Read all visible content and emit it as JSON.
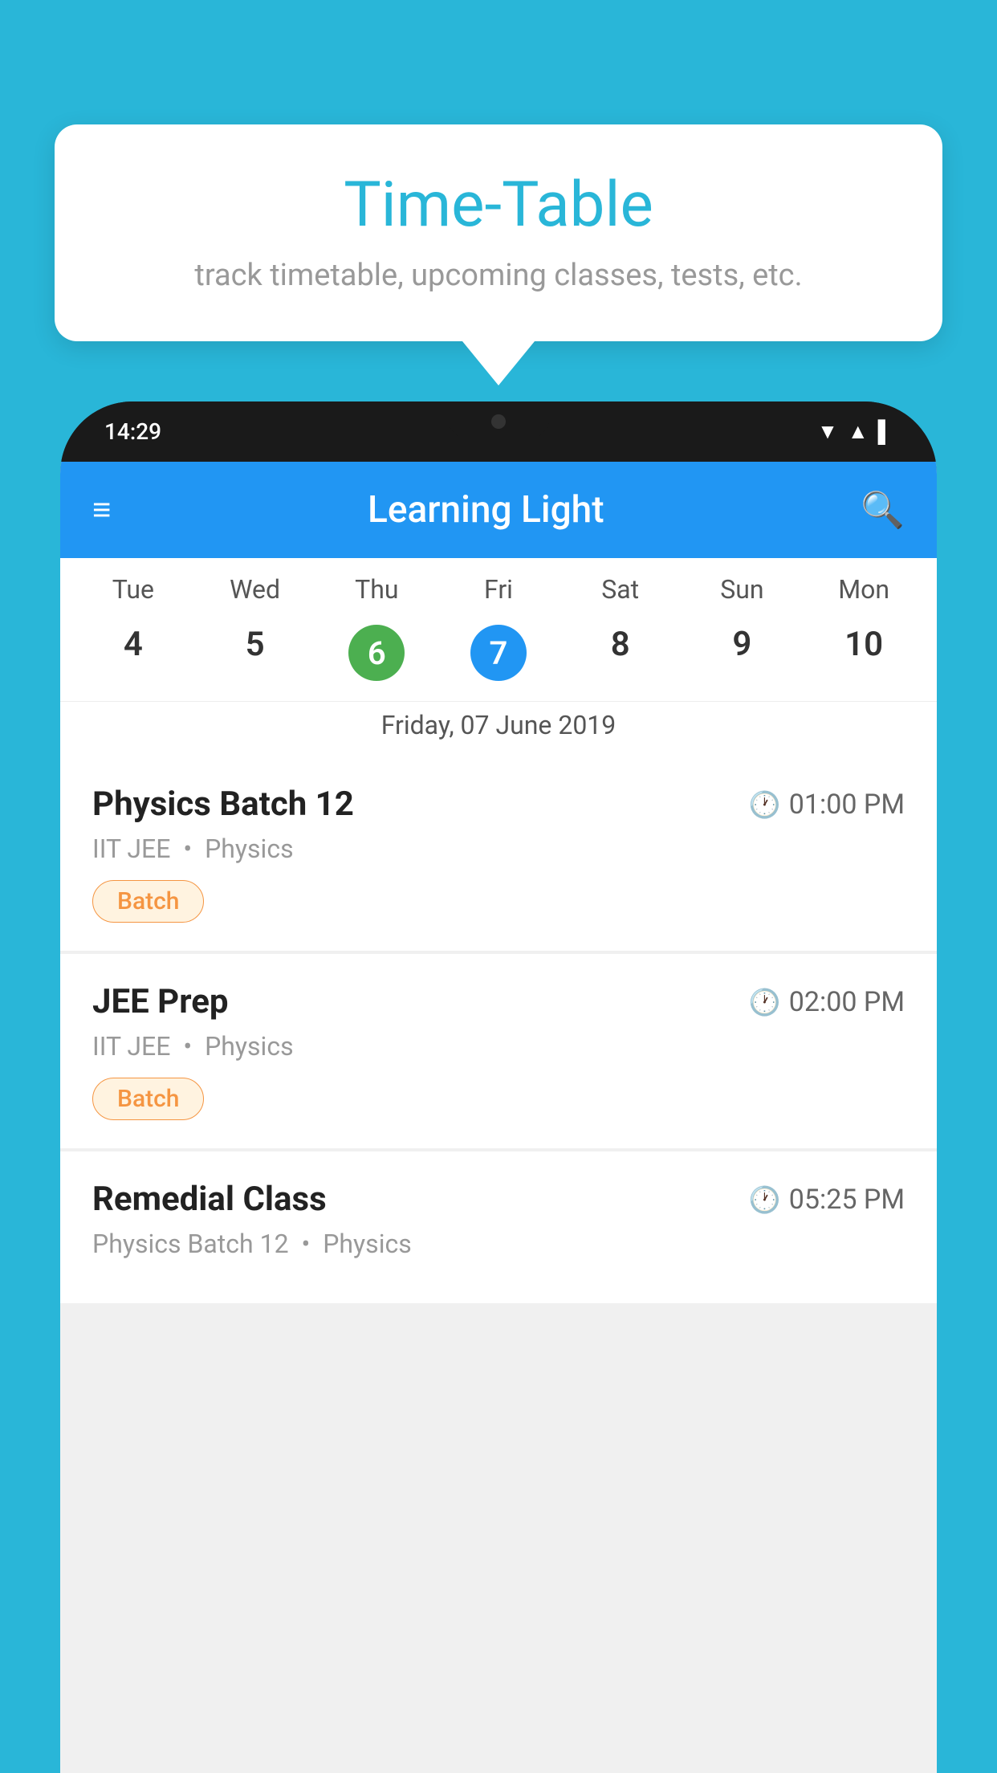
{
  "page": {
    "background_color": "#29B6D8"
  },
  "speech_bubble": {
    "title": "Time-Table",
    "subtitle": "track timetable, upcoming classes, tests, etc."
  },
  "phone": {
    "status_bar": {
      "time": "14:29"
    },
    "app_bar": {
      "title": "Learning Light"
    },
    "calendar": {
      "days": [
        "Tue",
        "Wed",
        "Thu",
        "Fri",
        "Sat",
        "Sun",
        "Mon"
      ],
      "dates": [
        "4",
        "5",
        "6",
        "7",
        "8",
        "9",
        "10"
      ],
      "today_index": 2,
      "selected_index": 3,
      "selected_date_label": "Friday, 07 June 2019"
    },
    "schedule": [
      {
        "title": "Physics Batch 12",
        "time": "01:00 PM",
        "subtitle_course": "IIT JEE",
        "subtitle_subject": "Physics",
        "badge": "Batch"
      },
      {
        "title": "JEE Prep",
        "time": "02:00 PM",
        "subtitle_course": "IIT JEE",
        "subtitle_subject": "Physics",
        "badge": "Batch"
      },
      {
        "title": "Remedial Class",
        "time": "05:25 PM",
        "subtitle_course": "Physics Batch 12",
        "subtitle_subject": "Physics",
        "badge": ""
      }
    ]
  },
  "icons": {
    "hamburger": "≡",
    "search": "🔍",
    "clock": "🕐"
  }
}
